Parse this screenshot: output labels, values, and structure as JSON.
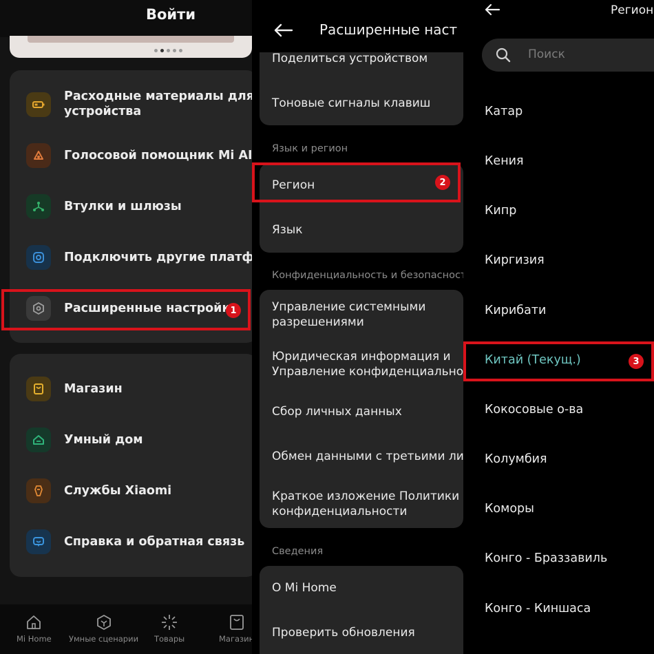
{
  "colors": {
    "highlight_red": "#d8131b",
    "current_teal": "#6fc7c2",
    "card_bg": "#262626"
  },
  "panel1": {
    "title": "Войти",
    "menu_group1": [
      {
        "label_line1": "Расходные материалы для",
        "label_line2": "устройства",
        "icon": "battery-icon",
        "color": "#e5a72e"
      },
      {
        "label": "Голосовой помощник Mi AI",
        "icon": "mi-ai-icon",
        "color": "#e07b3c"
      },
      {
        "label": "Втулки и шлюзы",
        "icon": "hub-icon",
        "color": "#35b36b"
      },
      {
        "label": "Подключить другие платформ",
        "icon": "connect-platform-icon",
        "color": "#3b8fd8"
      },
      {
        "label": "Расширенные настройки",
        "icon": "settings-hexagon-icon",
        "color": "#8a8a8a"
      }
    ],
    "menu_group2": [
      {
        "label": "Магазин",
        "icon": "store-icon",
        "color": "#e5b02e"
      },
      {
        "label": "Умный дом",
        "icon": "smart-home-icon",
        "color": "#2fb37a"
      },
      {
        "label": "Службы Xiaomi",
        "icon": "xiaomi-service-icon",
        "color": "#e38a35"
      },
      {
        "label": "Справка и обратная связь",
        "icon": "feedback-icon",
        "color": "#3b95de"
      }
    ],
    "badge": "1",
    "bottom_nav": [
      {
        "label": "Mi Home",
        "icon": "home-icon"
      },
      {
        "label": "Умные сценарии",
        "icon": "scenes-icon"
      },
      {
        "label": "Товары",
        "icon": "sparkle-icon"
      },
      {
        "label": "Магазин",
        "icon": "bag-icon"
      }
    ]
  },
  "panel2": {
    "title": "Расширенные наст",
    "group1": [
      "Поделиться устройством",
      "Тоновые сигналы клавиш"
    ],
    "section_lang": "Язык и регион",
    "group2": [
      "Регион",
      "Язык"
    ],
    "section_privacy": "Конфиденциальность и безопасност",
    "group3": {
      "item1_line1": "Управление системными",
      "item1_line2": "разрешениями",
      "item2_line1": "Юридическая информация и",
      "item2_line2": "Управление конфиденциальнос",
      "item3": "Сбор личных данных",
      "item4": "Обмен данными с третьими ли",
      "item5_line1": "Краткое изложение Политики",
      "item5_line2": "конфиденциальности"
    },
    "section_info": "Сведения",
    "group4": [
      "О Mi Home",
      "Проверить обновления"
    ],
    "badge": "2"
  },
  "panel3": {
    "title": "Регион",
    "search_placeholder": "Поиск",
    "regions": [
      "Катар",
      "Кения",
      "Кипр",
      "Киргизия",
      "Кирибати",
      "Китай (Текущ.)",
      "Кокосовые о-ва",
      "Колумбия",
      "Коморы",
      "Конго - Браззавиль",
      "Конго - Киншаса"
    ],
    "current_index": 5,
    "badge": "3"
  }
}
